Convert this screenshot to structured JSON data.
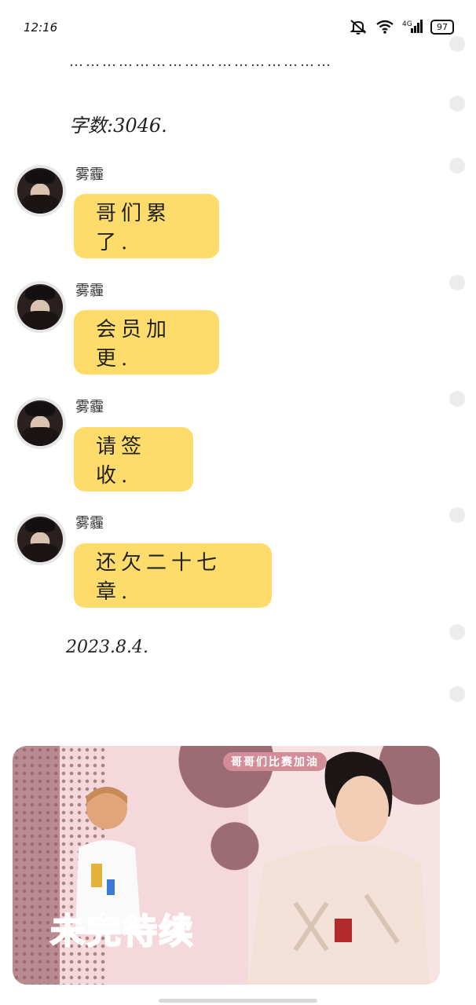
{
  "status_bar": {
    "time": "12:16",
    "battery": "97"
  },
  "content": {
    "ellipsis": "…………………………………………",
    "word_count": "字数:3046.",
    "messages": [
      {
        "sender": "雾霾",
        "text": "哥们累了."
      },
      {
        "sender": "雾霾",
        "text": "会员加更."
      },
      {
        "sender": "雾霾",
        "text": "请签收."
      },
      {
        "sender": "雾霾",
        "text": "还欠二十七章."
      }
    ],
    "date": "2023.8.4."
  },
  "banner": {
    "tagline": "哥哥们比赛加油",
    "title": "未完待续",
    "colors": {
      "accent": "#e37f92",
      "bubble": "#fddc6b"
    }
  }
}
